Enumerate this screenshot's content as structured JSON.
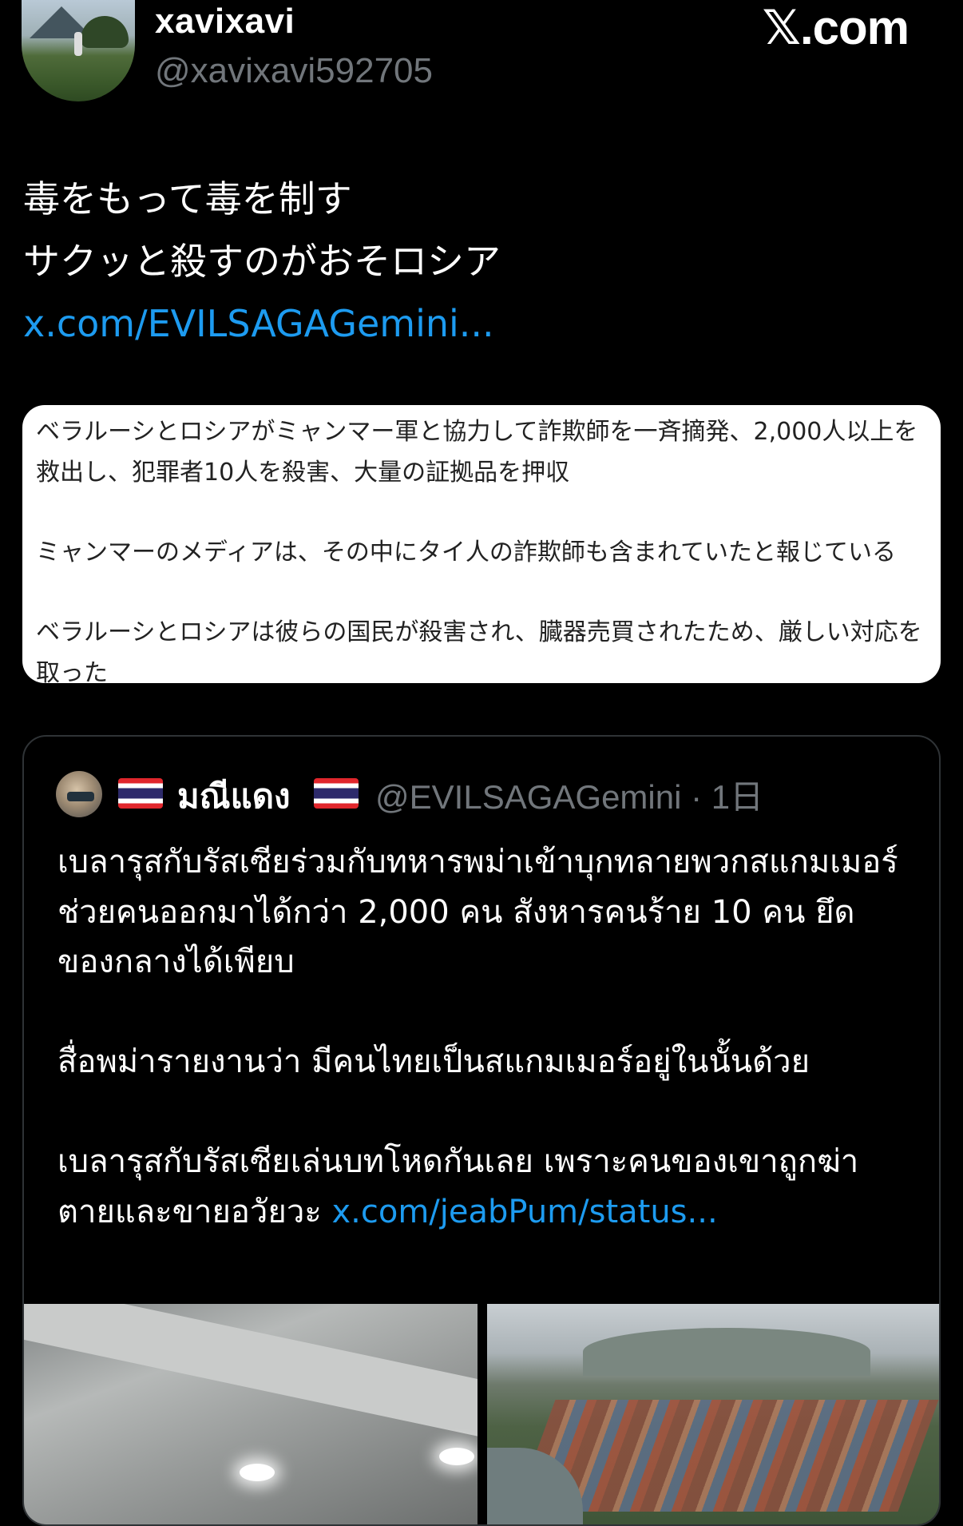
{
  "author": {
    "display_name": "xavixavi",
    "handle": "@xavixavi592705"
  },
  "brand": "𝕏.com",
  "tweet": {
    "line1": "毒をもって毒を制す",
    "line2": "サクッと殺すのがおそロシア",
    "link": "x.com/EVILSAGAGemini..."
  },
  "translation": {
    "para1": "ベラルーシとロシアがミャンマー軍と協力して詐欺師を一斉摘発、2,000人以上を救出し、犯罪者10人を殺害、大量の証拠品を押収",
    "para2": "ミャンマーのメディアは、その中にタイ人の詐欺師も含まれていたと報じている",
    "para3": "ベラルーシとロシアは彼らの国民が殺害され、臓器売買されたため、厳しい対応を取った"
  },
  "quote": {
    "name": "มณีแดง",
    "handle_time": "@EVILSAGAGemini · 1日",
    "para1": "เบลารุสกับรัสเซียร่วมกับทหารพม่าเข้าบุกทลายพวกสแกมเมอร์ ช่วยคนออกมาได้กว่า 2,000 คน สังหารคนร้าย 10 คน ยึดของกลางได้เพียบ",
    "para2": "สื่อพม่ารายงานว่า มีคนไทยเป็นสแกมเมอร์อยู่ในนั้นด้วย",
    "para3": "เบลารุสกับรัสเซียเล่นบทโหดกันเลย เพราะคนของเขาถูกฆ่าตายและขายอวัยวะ ",
    "link": "x.com/jeabPum/status..."
  },
  "colors": {
    "background": "#000000",
    "text": "#e7e9ea",
    "muted": "#71767b",
    "link": "#1d9bf0",
    "card": "#ffffff"
  }
}
